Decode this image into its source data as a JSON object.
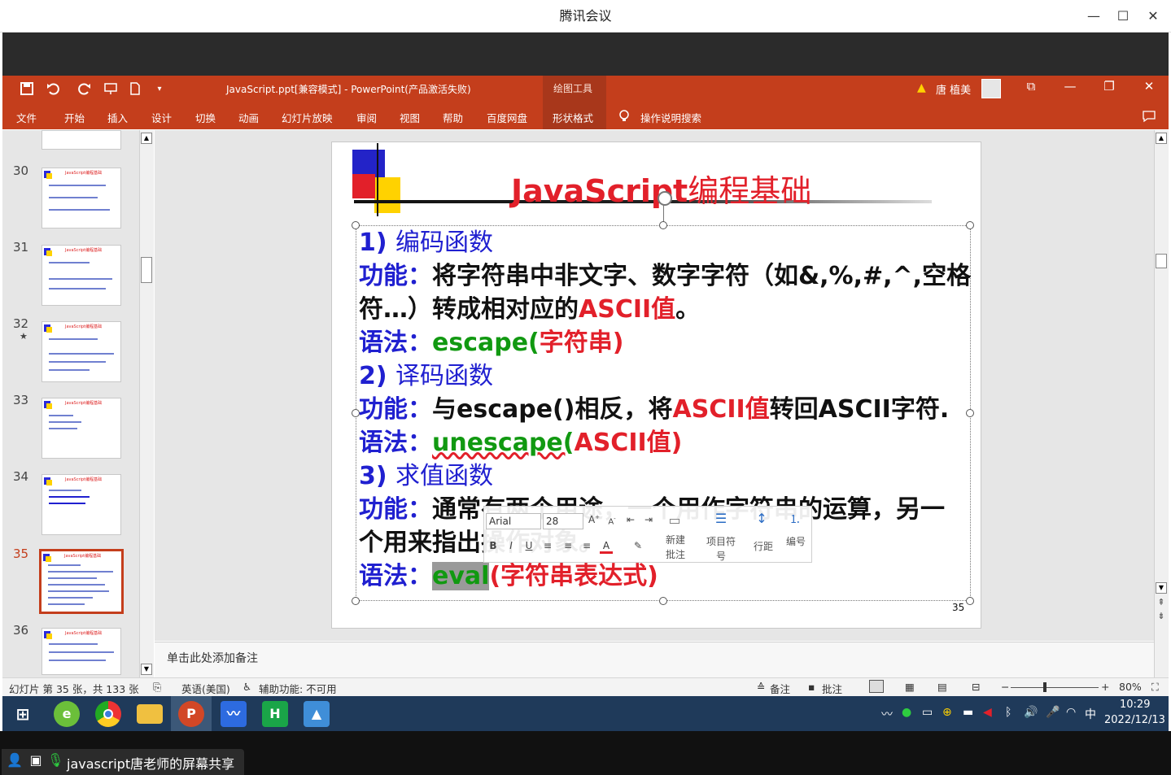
{
  "window": {
    "title": "腾讯会议",
    "controls": [
      "—",
      "☐",
      "✕"
    ]
  },
  "ppt": {
    "doc_title": "JavaScript.ppt[兼容模式]  -  PowerPoint(产品激活失败)",
    "drawing_tools": "绘图工具",
    "user": "唐 植美",
    "tabs": [
      "文件",
      "开始",
      "插入",
      "设计",
      "切换",
      "动画",
      "幻灯片放映",
      "审阅",
      "视图",
      "帮助",
      "百度网盘",
      "形状格式"
    ],
    "tell_me": "操作说明搜索",
    "qat_icons": [
      "save-icon",
      "undo-icon",
      "redo-icon",
      "presenter-icon",
      "new-doc-icon",
      "customize-icon"
    ]
  },
  "thumbnails": [
    {
      "num": "30",
      "star": ""
    },
    {
      "num": "31",
      "star": ""
    },
    {
      "num": "32",
      "star": "★"
    },
    {
      "num": "33",
      "star": ""
    },
    {
      "num": "34",
      "star": ""
    },
    {
      "num": "35",
      "star": ""
    },
    {
      "num": "36",
      "star": ""
    }
  ],
  "thumbnail_title": "JavaScript编程基础",
  "slide": {
    "title_latin": "JavaScript",
    "title_cn": "编程基础",
    "number": "35",
    "l1_num": "1)",
    "l1_text": "编码函数",
    "l2_label": "功能：",
    "l2_text": "将字符串中非文字、数字字符（如&,%,#,^,空格",
    "l3_text": "符…）转成相对应的",
    "l3_red": "ASCII值",
    "l3_end": "。",
    "l4_label": "语法：",
    "l4_green": "escape(",
    "l4_red": "字符串",
    "l4_close": ")",
    "l5_num": "2)",
    "l5_text": "译码函数",
    "l6_label": "功能：",
    "l6_text": "与escape()相反，将",
    "l6_red": "ASCII值",
    "l6_end": "转回ASCII字符.",
    "l7_label": "语法：",
    "l7_green": "unescape(",
    "l7_red": "ASCII值",
    "l7_close": ")",
    "l8_num": "3)",
    "l8_text": "求值函数",
    "l9_label": "功能：",
    "l9_text": "通常有两个用途，一个用作字符串的运算，另一",
    "l10_text": "个用来指出操作对象。",
    "l11_label": "语法：",
    "l11_green": "eval",
    "l11_paren": "(",
    "l11_red": "字符串表达式",
    "l11_close": ")"
  },
  "mini_toolbar": {
    "font": "Arial",
    "size": "28",
    "new_comment": [
      "新建",
      "批注"
    ],
    "bullets": [
      "项目符",
      "号"
    ],
    "line_spacing": "行距",
    "numbering": "编号"
  },
  "notes_placeholder": "单击此处添加备注",
  "status": {
    "slide_info": "幻灯片 第 35 张，共 133 张",
    "language": "英语(美国)",
    "accessibility": "辅助功能: 不可用",
    "notes": "备注",
    "comments": "批注",
    "zoom": "80%"
  },
  "taskbar": {
    "time": "10:29",
    "date": "2022/12/13",
    "ime": "中"
  },
  "share": {
    "text": "javascript唐老师的屏幕共享"
  }
}
